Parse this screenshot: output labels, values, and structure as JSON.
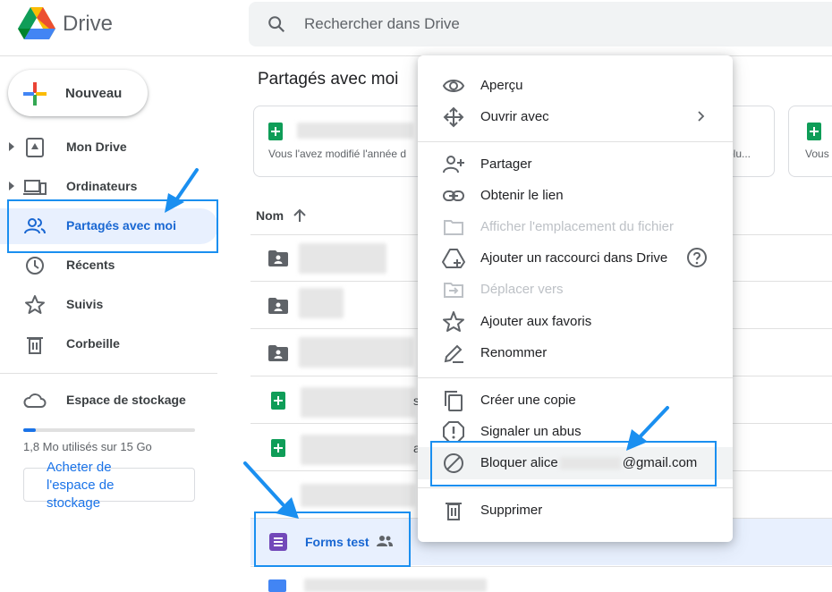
{
  "header": {
    "brand": "Drive",
    "search_placeholder": "Rechercher dans Drive"
  },
  "sidebar": {
    "new_label": "Nouveau",
    "items": [
      {
        "label": "Mon Drive",
        "icon": "drive-icon"
      },
      {
        "label": "Ordinateurs",
        "icon": "computers-icon"
      },
      {
        "label": "Partagés avec moi",
        "icon": "shared-icon",
        "active": true
      },
      {
        "label": "Récents",
        "icon": "clock-icon"
      },
      {
        "label": "Suivis",
        "icon": "star-icon"
      },
      {
        "label": "Corbeille",
        "icon": "trash-icon"
      }
    ],
    "storage": {
      "label": "Espace de stockage",
      "usage": "1,8 Mo utilisés sur 15 Go",
      "buy": "Acheter de l'espace de stockage"
    }
  },
  "main": {
    "title": "Partagés avec moi",
    "cards": [
      {
        "subtitle": "Vous l'avez modifié l'année d"
      },
      {
        "subtitle": "olu..."
      },
      {
        "subtitle": "Vous"
      }
    ],
    "column_name": "Nom",
    "row_fragments": [
      "s",
      "a"
    ],
    "forms_file": "Forms test"
  },
  "context_menu": {
    "items": [
      {
        "label": "Aperçu",
        "icon": "eye-icon"
      },
      {
        "label": "Ouvrir avec",
        "icon": "move-icon",
        "submenu": true
      },
      {
        "label": "Partager",
        "icon": "person-add-icon"
      },
      {
        "label": "Obtenir le lien",
        "icon": "link-icon"
      },
      {
        "label": "Afficher l'emplacement du fichier",
        "icon": "folder-icon",
        "disabled": true
      },
      {
        "label": "Ajouter un raccourci dans Drive",
        "icon": "drive-shortcut-icon",
        "help": true
      },
      {
        "label": "Déplacer vers",
        "icon": "move-to-icon",
        "disabled": true
      },
      {
        "label": "Ajouter aux favoris",
        "icon": "star-icon"
      },
      {
        "label": "Renommer",
        "icon": "pencil-icon"
      },
      {
        "label": "Créer une copie",
        "icon": "copy-icon"
      },
      {
        "label": "Signaler un abus",
        "icon": "report-icon"
      },
      {
        "label_prefix": "Bloquer alice",
        "label_suffix": "@gmail.com",
        "icon": "block-icon"
      },
      {
        "label": "Supprimer",
        "icon": "trash-icon"
      }
    ]
  },
  "colors": {
    "accent": "#1a73e8",
    "callout": "#1a8ff0",
    "active_bg": "#e8f0fe",
    "sheets_green": "#0f9d58",
    "forms_purple": "#7248b9"
  }
}
